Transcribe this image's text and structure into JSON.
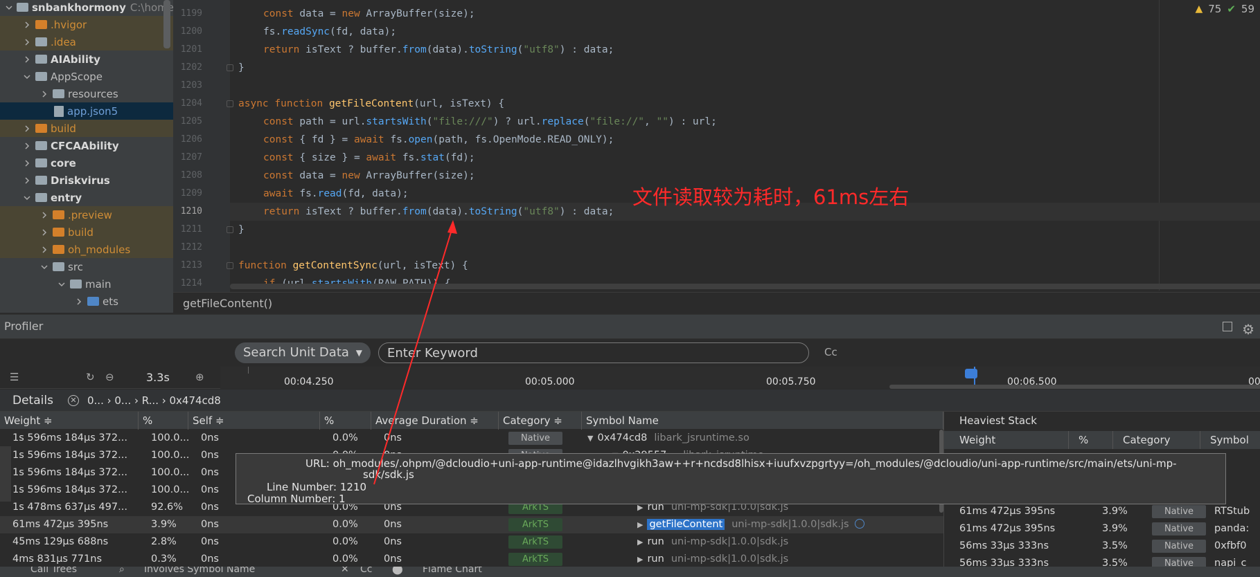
{
  "project": {
    "items": [
      {
        "label": "snbankhormony",
        "path": "C:\\home\\",
        "style": "bold",
        "folder": "plain",
        "indent": 0,
        "expanded": true
      },
      {
        "label": ".hvigor",
        "style": "orange",
        "folder": "orange",
        "indent": 1,
        "expanded": false,
        "excluded": true
      },
      {
        "label": ".idea",
        "style": "orange",
        "folder": "plain",
        "indent": 1,
        "expanded": false,
        "excluded": true
      },
      {
        "label": "AIAbility",
        "style": "bold",
        "folder": "plain",
        "indent": 1,
        "expanded": false
      },
      {
        "label": "AppScope",
        "style": "normal",
        "folder": "plain",
        "indent": 1,
        "expanded": true
      },
      {
        "label": "resources",
        "style": "normal",
        "folder": "plain",
        "indent": 2,
        "expanded": false
      },
      {
        "label": "app.json5",
        "style": "blue",
        "folder": "file",
        "indent": 2,
        "selected": true
      },
      {
        "label": "build",
        "style": "orange",
        "folder": "orange",
        "indent": 1,
        "expanded": false,
        "excluded": true
      },
      {
        "label": "CFCAAbility",
        "style": "bold",
        "folder": "plain",
        "indent": 1,
        "expanded": false
      },
      {
        "label": "core",
        "style": "bold",
        "folder": "plain",
        "indent": 1,
        "expanded": false
      },
      {
        "label": "Driskvirus",
        "style": "bold",
        "folder": "plain",
        "indent": 1,
        "expanded": false
      },
      {
        "label": "entry",
        "style": "bold",
        "folder": "plain",
        "indent": 1,
        "expanded": true
      },
      {
        "label": ".preview",
        "style": "orange",
        "folder": "orange",
        "indent": 2,
        "expanded": false,
        "excluded": true
      },
      {
        "label": "build",
        "style": "orange",
        "folder": "orange",
        "indent": 2,
        "expanded": false,
        "excluded": true
      },
      {
        "label": "oh_modules",
        "style": "orange",
        "folder": "orange",
        "indent": 2,
        "expanded": false,
        "excluded": true
      },
      {
        "label": "src",
        "style": "normal",
        "folder": "plain",
        "indent": 2,
        "expanded": true
      },
      {
        "label": "main",
        "style": "normal",
        "folder": "plain",
        "indent": 3,
        "expanded": true
      },
      {
        "label": "ets",
        "style": "normal",
        "folder": "blue",
        "indent": 4,
        "expanded": false
      }
    ]
  },
  "editor": {
    "warnings_count": "75",
    "ok_count": "59",
    "lines": [
      {
        "num": "1199",
        "indent": 1,
        "tokens": [
          [
            "kw",
            "const "
          ],
          [
            "pl",
            "data = "
          ],
          [
            "kw",
            "new "
          ],
          [
            "pl",
            "ArrayBuffer(size);"
          ]
        ]
      },
      {
        "num": "1200",
        "indent": 1,
        "tokens": [
          [
            "pl",
            "fs."
          ],
          [
            "mt",
            "readSync"
          ],
          [
            "pl",
            "(fd, data);"
          ]
        ]
      },
      {
        "num": "1201",
        "indent": 1,
        "tokens": [
          [
            "kw",
            "return "
          ],
          [
            "pl",
            "isText ? buffer."
          ],
          [
            "mt",
            "from"
          ],
          [
            "pl",
            "(data)."
          ],
          [
            "mt",
            "toString"
          ],
          [
            "pl",
            "("
          ],
          [
            "st",
            "\"utf8\""
          ],
          [
            "pl",
            ") : data;"
          ]
        ]
      },
      {
        "num": "1202",
        "indent": 0,
        "tokens": [
          [
            "pl",
            "}"
          ]
        ]
      },
      {
        "num": "1203",
        "indent": 0,
        "tokens": []
      },
      {
        "num": "1204",
        "indent": 0,
        "tokens": [
          [
            "kw",
            "async function "
          ],
          [
            "fn",
            "getFileContent"
          ],
          [
            "pl",
            "(url, isText) {"
          ]
        ]
      },
      {
        "num": "1205",
        "indent": 1,
        "tokens": [
          [
            "kw",
            "const "
          ],
          [
            "pl",
            "path = url."
          ],
          [
            "mt",
            "startsWith"
          ],
          [
            "pl",
            "("
          ],
          [
            "st",
            "\"file:///\""
          ],
          [
            "pl",
            ") ? url."
          ],
          [
            "mt",
            "replace"
          ],
          [
            "pl",
            "("
          ],
          [
            "st",
            "\"file://\""
          ],
          [
            "pl",
            ", "
          ],
          [
            "st",
            "\"\""
          ],
          [
            "pl",
            ") : url;"
          ]
        ]
      },
      {
        "num": "1206",
        "indent": 1,
        "tokens": [
          [
            "kw",
            "const "
          ],
          [
            "pl",
            "{ fd } = "
          ],
          [
            "kw",
            "await "
          ],
          [
            "pl",
            "fs."
          ],
          [
            "mt",
            "open"
          ],
          [
            "pl",
            "(path, fs.OpenMode.READ_ONLY);"
          ]
        ]
      },
      {
        "num": "1207",
        "indent": 1,
        "tokens": [
          [
            "kw",
            "const "
          ],
          [
            "pl",
            "{ size } = "
          ],
          [
            "kw",
            "await "
          ],
          [
            "pl",
            "fs."
          ],
          [
            "mt",
            "stat"
          ],
          [
            "pl",
            "(fd);"
          ]
        ]
      },
      {
        "num": "1208",
        "indent": 1,
        "tokens": [
          [
            "kw",
            "const "
          ],
          [
            "pl",
            "data = "
          ],
          [
            "kw",
            "new "
          ],
          [
            "pl",
            "ArrayBuffer(size);"
          ]
        ]
      },
      {
        "num": "1209",
        "indent": 1,
        "tokens": [
          [
            "kw",
            "await "
          ],
          [
            "pl",
            "fs."
          ],
          [
            "mt",
            "read"
          ],
          [
            "pl",
            "(fd, data);"
          ]
        ]
      },
      {
        "num": "1210",
        "indent": 1,
        "current": true,
        "tokens": [
          [
            "kw",
            "return "
          ],
          [
            "pl",
            "isText ? buffer."
          ],
          [
            "mt",
            "from"
          ],
          [
            "pl",
            "(data)."
          ],
          [
            "mt",
            "toString"
          ],
          [
            "pl",
            "("
          ],
          [
            "st",
            "\"utf8\""
          ],
          [
            "pl",
            ") : data;"
          ]
        ]
      },
      {
        "num": "1211",
        "indent": 0,
        "tokens": [
          [
            "pl",
            "}"
          ]
        ]
      },
      {
        "num": "1212",
        "indent": 0,
        "tokens": []
      },
      {
        "num": "1213",
        "indent": 0,
        "tokens": [
          [
            "kw",
            "function "
          ],
          [
            "fn",
            "getContentSync"
          ],
          [
            "pl",
            "(url, isText) {"
          ]
        ]
      },
      {
        "num": "1214",
        "indent": 1,
        "tokens": [
          [
            "kw",
            "if "
          ],
          [
            "pl",
            "(url."
          ],
          [
            "mt",
            "startsWith"
          ],
          [
            "pl",
            "(RAW_PATH)) {"
          ]
        ]
      }
    ],
    "annotation": "文件读取较为耗时，61ms左右",
    "breadcrumb": "getFileContent()"
  },
  "profiler": {
    "title": "Profiler",
    "search_unit": "Search Unit Data",
    "keyword_placeholder": "Enter Keyword",
    "case_toggle": "Cc",
    "zoom": "3.3s",
    "ticks": [
      "00:04.250",
      "00:05.000",
      "00:05.750",
      "00:06.500",
      "00"
    ],
    "details_title": "Details",
    "crumbs": "0... › 0... › R... › 0x474cd8",
    "columns": [
      "Weight ≑",
      "%",
      "Self ≑",
      "%",
      "Average Duration ≑",
      "Category ≑",
      "Symbol Name"
    ],
    "rows": [
      {
        "weight": "1s 596ms 184μs 372...",
        "pct": "100.0...",
        "self": "0ns",
        "self_pct": "0.0%",
        "avg": "0ns",
        "category": "Native",
        "symbol": "0x474cd8",
        "lib": "libark_jsruntime.so",
        "arrow": "▼",
        "sym_indent": 0
      },
      {
        "weight": "1s 596ms 184μs 372...",
        "pct": "100.0...",
        "self": "0ns",
        "self_pct": "0.0%",
        "avg": "0ns",
        "category": "Native",
        "symbol": "0x29557...",
        "lib": "libark_jsruntime",
        "arrow": "▼",
        "sym_indent": 1
      },
      {
        "weight": "1s 596ms 184μs 372...",
        "pct": "100.0...",
        "self": "0ns",
        "self_pct": "",
        "avg": "",
        "category": "",
        "symbol": "",
        "lib": "",
        "arrow": "",
        "sym_indent": 0
      },
      {
        "weight": "1s 596ms 184μs 372...",
        "pct": "100.0...",
        "self": "0ns",
        "self_pct": "",
        "avg": "",
        "category": "",
        "symbol": "",
        "lib": "",
        "arrow": "",
        "sym_indent": 0
      },
      {
        "weight": "1s 478ms 637μs 497...",
        "pct": "92.6%",
        "self": "0ns",
        "self_pct": "0.0%",
        "avg": "0ns",
        "category": "ArkTS",
        "symbol": "run",
        "lib": "uni-mp-sdk|1.0.0|sdk.js",
        "arrow": "▶",
        "sym_indent": 2
      },
      {
        "weight": "61ms 472μs 395ns",
        "pct": "3.9%",
        "self": "0ns",
        "self_pct": "0.0%",
        "avg": "0ns",
        "category": "ArkTS",
        "symbol": "getFileContent",
        "lib": "uni-mp-sdk|1.0.0|sdk.js",
        "arrow": "▶",
        "sym_indent": 2,
        "selected": true,
        "highlight": true
      },
      {
        "weight": "45ms 129μs 688ns",
        "pct": "2.8%",
        "self": "0ns",
        "self_pct": "0.0%",
        "avg": "0ns",
        "category": "ArkTS",
        "symbol": "run",
        "lib": "uni-mp-sdk|1.0.0|sdk.js",
        "arrow": "▶",
        "sym_indent": 2
      },
      {
        "weight": "4ms 831μs 771ns",
        "pct": "0.3%",
        "self": "0ns",
        "self_pct": "0.0%",
        "avg": "0ns",
        "category": "ArkTS",
        "symbol": "run",
        "lib": "uni-mp-sdk|1.0.0|sdk.js",
        "arrow": "▶",
        "sym_indent": 2
      }
    ],
    "heaviest": {
      "title": "Heaviest Stack",
      "columns": [
        "Weight",
        "%",
        "Category",
        "Symbol"
      ],
      "rows": [
        {
          "weight": "61ms 472μs 395ns",
          "pct": "3.9%",
          "category": "Native",
          "symbol": "RTStub"
        },
        {
          "weight": "61ms 472μs 395ns",
          "pct": "3.9%",
          "category": "Native",
          "symbol": "panda:"
        },
        {
          "weight": "56ms 33μs 333ns",
          "pct": "3.5%",
          "category": "Native",
          "symbol": "0xfbf0"
        },
        {
          "weight": "56ms 33μs 333ns",
          "pct": "3.5%",
          "category": "Native",
          "symbol": "napi_c"
        }
      ]
    },
    "tooltip": {
      "url_key": "URL:",
      "url_value": "oh_modules/.ohpm/@dcloudio+uni-app-runtime@idazlhvgikh3aw++r+ncdsd8lhisx+iuufxvzpgrtyy=/oh_modules/@dcloudio/uni-app-runtime/src/main/ets/uni-mp-",
      "url_value2": "sdk/sdk.js",
      "line_key": "Line Number:",
      "line_value": "1210",
      "col_key": "Column Number:",
      "col_value": "1"
    },
    "bottom": {
      "call_trees": "Call Trees",
      "involves": "Involves Symbol Name",
      "cc": "Cc",
      "flame": "Flame Chart"
    }
  }
}
